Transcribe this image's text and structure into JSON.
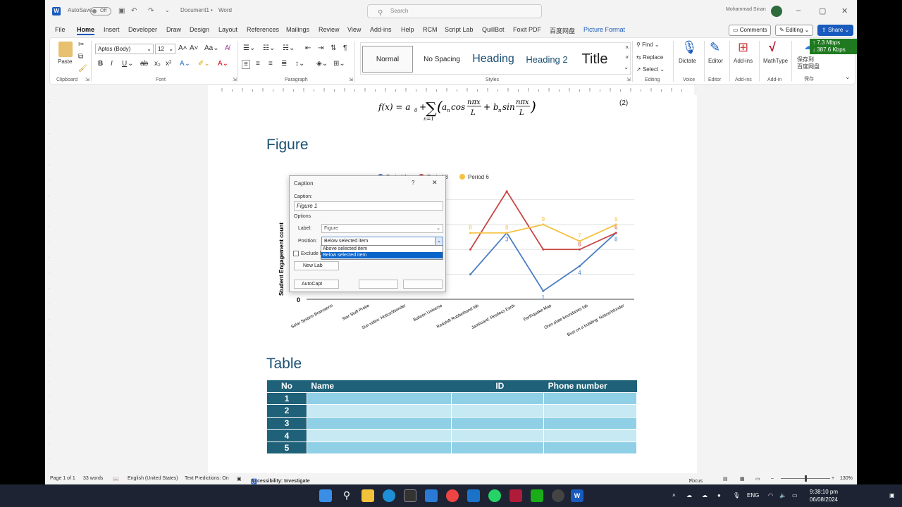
{
  "titlebar": {
    "autosave": "AutoSave",
    "autosave_state": "Off",
    "doc_title": "Document1",
    "app": "Word",
    "search_placeholder": "Search",
    "user": "Mohammad Sinan",
    "separator": "•"
  },
  "tabs": [
    "File",
    "Home",
    "Insert",
    "Developer",
    "Draw",
    "Design",
    "Layout",
    "References",
    "Mailings",
    "Review",
    "View",
    "Add-ins",
    "Help",
    "RCM",
    "Script Lab",
    "QuillBot",
    "Foxit PDF",
    "百度网盘",
    "Picture Format"
  ],
  "ribbon_right": {
    "comments": "Comments",
    "editing": "Editing",
    "share": "Share"
  },
  "network": {
    "up": "↑ 7.3 Mbps",
    "down": "↓ 387.6 Kbps"
  },
  "ribbon": {
    "paste": "Paste",
    "clipboard": "Clipboard",
    "font_name": "Aptos (Body)",
    "font_size": "12",
    "font": "Font",
    "paragraph": "Paragraph",
    "styles": [
      "Normal",
      "No Spacing",
      "Heading",
      "Heading 2",
      "Title"
    ],
    "styles_label": "Styles",
    "find": "Find",
    "replace": "Replace",
    "select": "Select",
    "editing_group": "Editing",
    "dictate": "Dictate",
    "voice": "Voice",
    "editor": "Editor",
    "editor_group": "Editor",
    "addins": "Add-ins",
    "addins_group": "Add-ins",
    "mathtype": "MathType",
    "addin_group": "Add-in",
    "baidu": "保存到\n百度网盘",
    "baidu_group": "保存"
  },
  "document": {
    "equation_number": "(2)",
    "figure_heading": "Figure",
    "table_heading": "Table"
  },
  "chart_data": {
    "type": "line",
    "ylabel": "Student Engagement count",
    "categories": [
      "Solar System Brainstorm",
      "Star Stuff Probe",
      "Sun video: Notice/Wonder",
      "Balloon Universe",
      "Redshift Rubberband lab",
      "Jamboard: Restless Earth",
      "Earthquake Map",
      "Oreo plate boundaries lab",
      "Bust on a building: Notice/Wonder"
    ],
    "ytick": "0",
    "legend": [
      "Period 1",
      "Period 3",
      "Period 6"
    ],
    "series": [
      {
        "name": "Period 1",
        "color": "#4a7ec2",
        "values": [
          null,
          null,
          null,
          null,
          3,
          8,
          1,
          4,
          8
        ]
      },
      {
        "name": "Period 3",
        "color": "#c94545",
        "values": [
          null,
          null,
          null,
          null,
          6,
          13,
          6,
          6,
          8
        ]
      },
      {
        "name": "Period 6",
        "color": "#f5c242",
        "values": [
          null,
          null,
          null,
          null,
          8,
          8,
          9,
          7,
          9
        ]
      }
    ],
    "data_labels": [
      {
        "series": "Period 1",
        "values": [
          "3",
          "1",
          "4",
          "8"
        ]
      },
      {
        "series": "Period 3",
        "values": [
          "6",
          "6"
        ]
      },
      {
        "series": "Period 6",
        "values": [
          "8",
          "8",
          "9",
          "7",
          "9"
        ]
      }
    ]
  },
  "caption_dialog": {
    "title": "Caption",
    "help": "?",
    "close": "✕",
    "caption_label": "Caption:",
    "caption_value": "Figure 1",
    "options": "Options",
    "label_label": "Label:",
    "label_value": "Figure",
    "position_label": "Position:",
    "position_value": "Below selected item",
    "position_options": [
      "Above selected item",
      "Below selected item"
    ],
    "exclude": "Exclude l",
    "new_label": "New Lab",
    "autocaption": "AutoCapt"
  },
  "table": {
    "headers": [
      "No",
      "Name",
      "ID",
      "Phone number"
    ],
    "rows": [
      "1",
      "2",
      "3",
      "4",
      "5"
    ]
  },
  "status": {
    "page": "Page 1 of 1",
    "words": "33 words",
    "language": "English (United States)",
    "predictions": "Text Predictions: On",
    "accessibility": "Accessibility: Investigate",
    "focus": "Focus",
    "zoom": "130%"
  },
  "taskbar": {
    "lang": "ENG",
    "time": "9:38:10 pm",
    "date": "06/08/2024"
  }
}
